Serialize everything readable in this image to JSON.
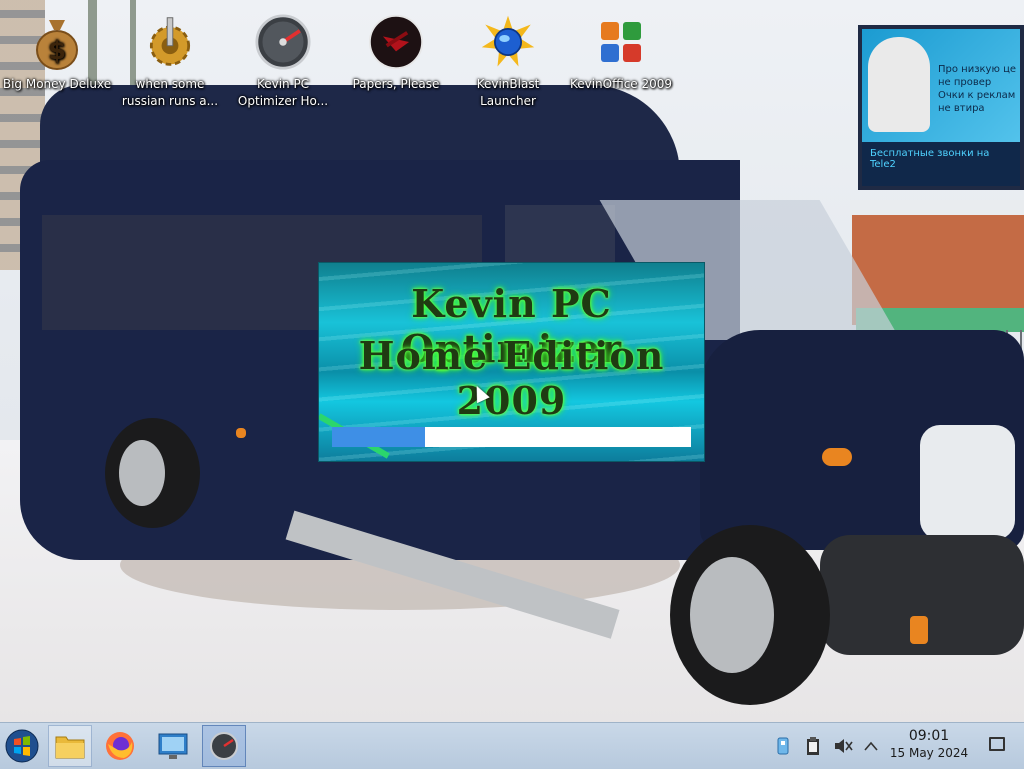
{
  "desktop": {
    "icons": [
      {
        "label": "Big Money Deluxe",
        "icon": "money-bag-icon"
      },
      {
        "label": "when some russian runs a...",
        "icon": "gear-tool-icon"
      },
      {
        "label": "Kevin PC Optimizer Ho...",
        "icon": "speedometer-icon"
      },
      {
        "label": "Papers, Please",
        "icon": "papers-please-icon"
      },
      {
        "label": "KevinBlast Launcher",
        "icon": "globe-burst-icon"
      },
      {
        "label": "KevinOffice 2009",
        "icon": "office-logo-icon"
      }
    ]
  },
  "wallpaper": {
    "billboard_line1": "Про низкую це",
    "billboard_line2": "не провер",
    "billboard_line3": "Очки к реклам",
    "billboard_line4": "не втира",
    "billboard_bottom": "Бесплатные звонки на Tele2"
  },
  "splash": {
    "title_line1": "Kevin PC Optimizer",
    "title_line2": "Home Edition 2009",
    "progress_fraction": 0.26,
    "colors": {
      "title_glow": "#3aff2c",
      "progress": "#3e8fe6"
    }
  },
  "taskbar": {
    "buttons": [
      {
        "name": "start-button",
        "icon": "windows-orb-icon"
      },
      {
        "name": "file-explorer-button",
        "icon": "folder-icon"
      },
      {
        "name": "firefox-button",
        "icon": "firefox-icon"
      },
      {
        "name": "control-panel-button",
        "icon": "control-panel-icon"
      },
      {
        "name": "kevin-optimizer-task-button",
        "icon": "speedometer-icon"
      }
    ],
    "tray": {
      "icons": [
        "network-icon",
        "clipboard-icon",
        "volume-muted-icon",
        "chevron-up-icon"
      ],
      "time": "09:01",
      "date": "15 May 2024"
    }
  }
}
